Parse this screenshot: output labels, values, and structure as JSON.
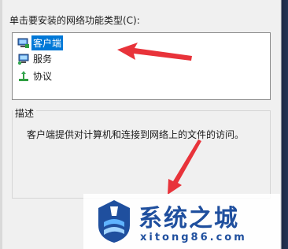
{
  "dialog": {
    "prompt": "单击要安装的网络功能类型(C):",
    "items": [
      {
        "label": "客户端",
        "icon": "network-client-icon",
        "selected": true
      },
      {
        "label": "服务",
        "icon": "network-service-icon",
        "selected": false
      },
      {
        "label": "协议",
        "icon": "network-protocol-icon",
        "selected": false
      }
    ],
    "description_title": "描述",
    "description_text": "客户端提供对计算机和连接到网络上的文件的访问。"
  },
  "annotations": {
    "arrow_color": "#e8333a"
  },
  "watermark": {
    "title": "系统之城",
    "url": "xitong86.com",
    "color": "#1f4f9e"
  }
}
